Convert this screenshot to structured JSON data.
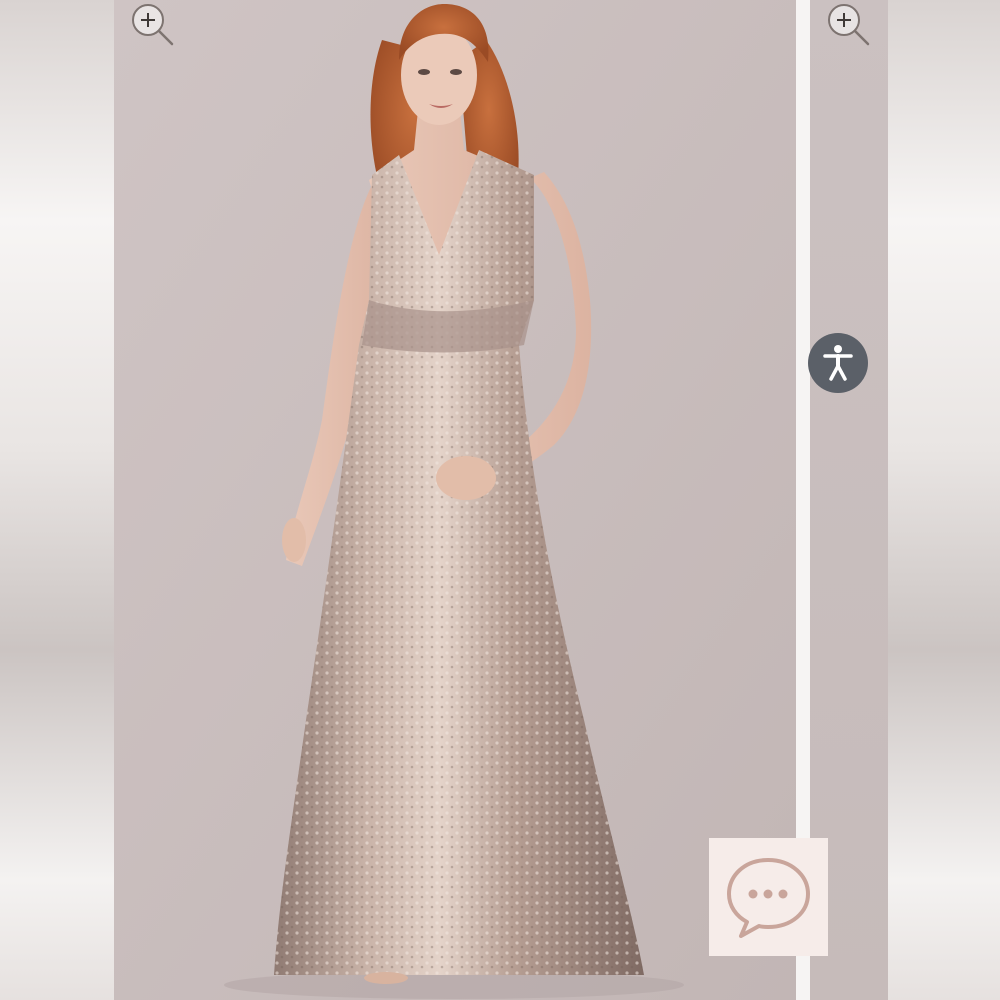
{
  "gallery": {
    "main_image": {
      "icon": "product-photo-sequin-gown",
      "dress_color": "#b59d92",
      "background_color": "#c9bebe"
    },
    "zoom_icon": "magnifier-plus-icon",
    "next_image_icon": "product-photo-partial"
  },
  "widgets": {
    "accessibility": {
      "icon": "accessibility-person-icon",
      "color": "#5b6068"
    },
    "chat": {
      "icon": "chat-bubble-dots-icon",
      "background": "#f6ece9",
      "stroke": "#c9a59b"
    }
  }
}
